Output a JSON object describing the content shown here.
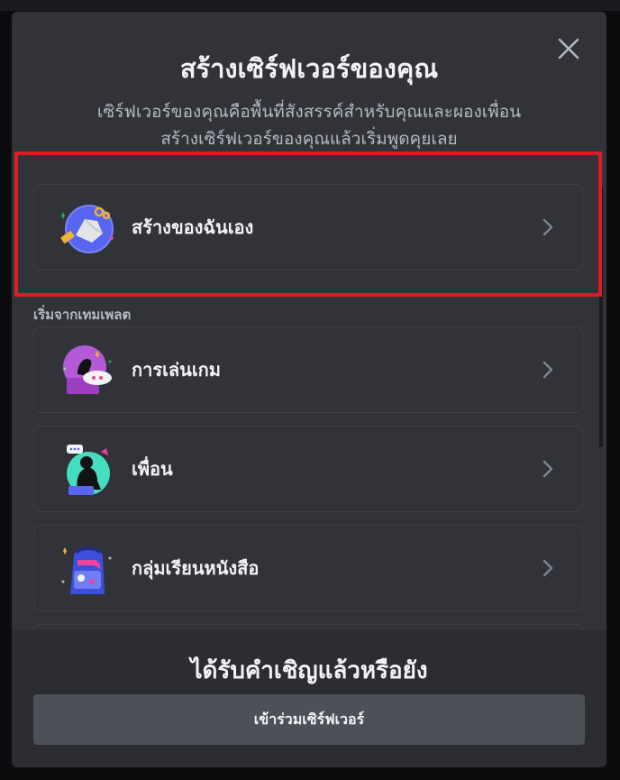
{
  "dialog": {
    "title": "สร้างเซิร์ฟเวอร์ของคุณ",
    "subtitle_line1": "เซิร์ฟเวอร์ของคุณคือพื้นที่สังสรรค์สำหรับคุณและผองเพื่อน",
    "subtitle_line2": "สร้างเซิร์ฟเวอร์ของคุณแล้วเริ่มพูดคุยเลย",
    "close_icon": "close-icon"
  },
  "create_own": {
    "label": "สร้างของฉันเอง",
    "icon": "create-own-illustration"
  },
  "templates": {
    "section_label": "เริ่มจากเทมเพลต",
    "items": [
      {
        "label": "การเล่นเกม",
        "icon": "gaming-illustration"
      },
      {
        "label": "เพื่อน",
        "icon": "friends-illustration"
      },
      {
        "label": "กลุ่มเรียนหนังสือ",
        "icon": "study-group-illustration"
      }
    ]
  },
  "footer": {
    "title": "ได้รับคำเชิญแล้วหรือยัง",
    "join_button": "เข้าร่วมเซิร์ฟเวอร์"
  },
  "colors": {
    "modal_bg": "#313338",
    "footer_bg": "#2b2d31",
    "option_border": "#3f4147",
    "button_bg": "#4e5058",
    "highlight_red": "#e01b24"
  }
}
